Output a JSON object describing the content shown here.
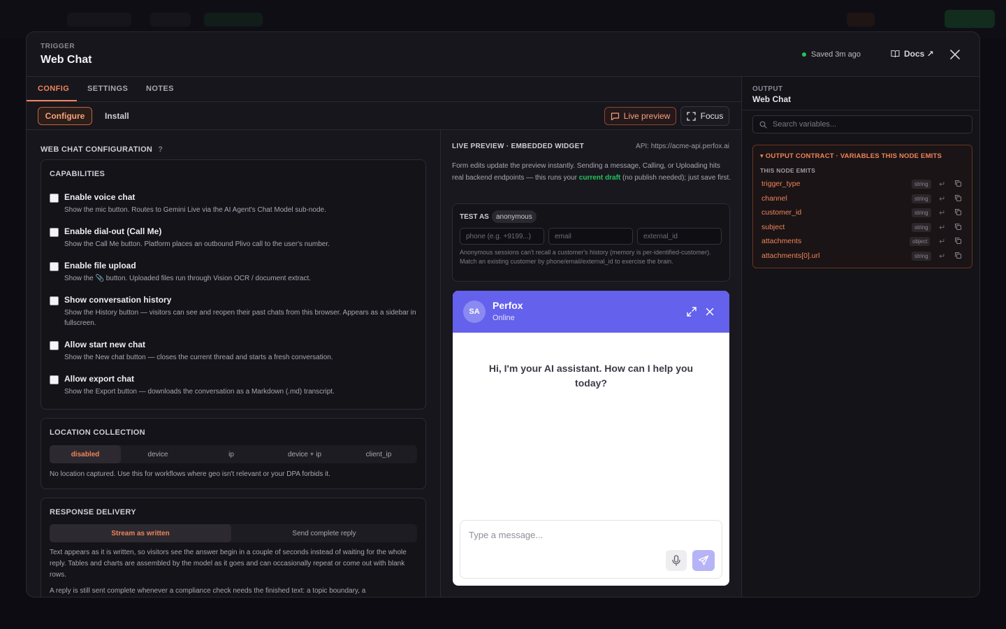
{
  "header": {
    "kicker": "TRIGGER",
    "title": "Web Chat",
    "saved_status": "Saved 3m ago",
    "docs_label": "Docs ↗"
  },
  "tabs": [
    {
      "label": "CONFIG",
      "active": true
    },
    {
      "label": "SETTINGS",
      "active": false
    },
    {
      "label": "NOTES",
      "active": false
    }
  ],
  "subtoolbar": {
    "configure_label": "Configure",
    "install_label": "Install",
    "live_preview_label": "Live preview",
    "focus_label": "Focus"
  },
  "config": {
    "title": "WEB CHAT CONFIGURATION",
    "help": "?",
    "capabilities": {
      "heading": "CAPABILITIES",
      "items": [
        {
          "label": "Enable voice chat",
          "desc": "Show the mic button. Routes to Gemini Live via the AI Agent's Chat Model sub-node.",
          "checked": false
        },
        {
          "label": "Enable dial-out (Call Me)",
          "desc": "Show the Call Me button. Platform places an outbound Plivo call to the user's number.",
          "checked": false
        },
        {
          "label": "Enable file upload",
          "desc": "Show the 📎 button. Uploaded files run through Vision OCR / document extract.",
          "checked": false
        },
        {
          "label": "Show conversation history",
          "desc": "Show the History button — visitors can see and reopen their past chats from this browser. Appears as a sidebar in fullscreen.",
          "checked": false
        },
        {
          "label": "Allow start new chat",
          "desc": "Show the New chat button — closes the current thread and starts a fresh conversation.",
          "checked": false
        },
        {
          "label": "Allow export chat",
          "desc": "Show the Export button — downloads the conversation as a Markdown (.md) transcript.",
          "checked": false
        }
      ]
    },
    "location": {
      "heading": "LOCATION COLLECTION",
      "options": [
        "disabled",
        "device",
        "ip",
        "device + ip",
        "client_ip"
      ],
      "selected": "disabled",
      "note": "No location captured. Use this for workflows where geo isn't relevant or your DPA forbids it."
    },
    "delivery": {
      "heading": "RESPONSE DELIVERY",
      "options": [
        "Stream as written",
        "Send complete reply"
      ],
      "selected": "Stream as written",
      "note1": "Text appears as it is written, so visitors see the answer begin in a couple of seconds instead of waiting for the whole reply. Tables and charts are assembled by the model as it goes and can occasionally repeat or come out with blank rows.",
      "note2": "A reply is still sent complete whenever a compliance check needs the finished text: a topic boundary, a"
    }
  },
  "preview": {
    "heading": "LIVE PREVIEW · EMBEDDED WIDGET",
    "api": "API: https://acme-api.perfox.ai",
    "desc_pre": "Form edits update the preview instantly. Sending a message, Calling, or Uploading hits real backend endpoints — this runs your ",
    "desc_highlight": "current draft",
    "desc_post": " (no publish needed); just save first.",
    "test_as": {
      "label": "TEST AS",
      "badge": "anonymous",
      "phone_placeholder": "phone (e.g. +9199...)",
      "email_placeholder": "email",
      "external_placeholder": "external_id",
      "note": "Anonymous sessions can't recall a customer's history (memory is per-identified-customer). Match an existing customer by phone/email/external_id to exercise the brain."
    },
    "widget": {
      "avatar": "SA",
      "name": "Perfox",
      "status": "Online",
      "greeting": "Hi, I'm your AI assistant. How can I help you today?",
      "input_placeholder": "Type a message...",
      "accent_color": "#6461ec"
    }
  },
  "output": {
    "kicker": "OUTPUT",
    "title": "Web Chat",
    "search_placeholder": "Search variables...",
    "contract_heading": "▾ OUTPUT CONTRACT · VARIABLES THIS NODE EMITS",
    "emits_label": "THIS NODE EMITS",
    "variables": [
      {
        "name": "trigger_type",
        "type": "string"
      },
      {
        "name": "channel",
        "type": "string"
      },
      {
        "name": "customer_id",
        "type": "string"
      },
      {
        "name": "subject",
        "type": "string"
      },
      {
        "name": "attachments",
        "type": "object"
      },
      {
        "name": "attachments[0].url",
        "type": "string"
      }
    ]
  },
  "colors": {
    "accent": "#f0845a",
    "status_online": "#22c55e",
    "highlight": "#22c55e"
  }
}
